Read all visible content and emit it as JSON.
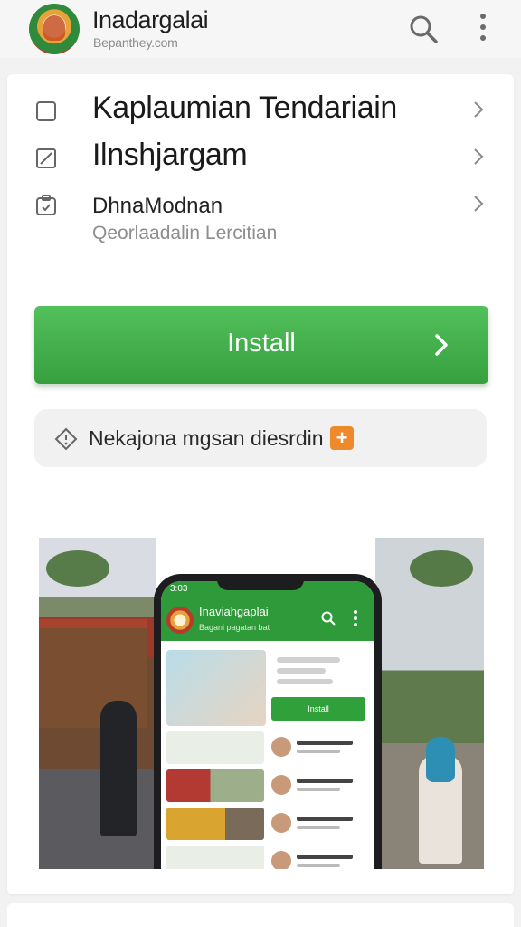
{
  "app_bar": {
    "title": "Inadargalai",
    "subtitle": "Bepanthey.com",
    "logo_icon": "emblem-logo",
    "search_icon": "search-icon",
    "more_icon": "more-vertical-icon"
  },
  "menu": {
    "items": [
      {
        "label": "Kaplaumian Tendariain",
        "icon": "checkbox-icon"
      },
      {
        "label": "Ilnshjargam",
        "icon": "edit-icon"
      },
      {
        "label": "DhnaModnan",
        "sublabel": "Qeorlaadalin Lercitian",
        "icon": "clipboard-icon"
      }
    ]
  },
  "install_button": {
    "label": "Install",
    "arrow_icon": "chevron-right-icon",
    "color": "#43b04c"
  },
  "notice": {
    "text": "Nekajona mgsan diesrdin",
    "icon": "diamond-info-icon",
    "plus_icon": "plus-icon",
    "plus_color": "#ef8a2c"
  },
  "preview": {
    "status_time": "3:03",
    "app_title": "Inaviahgaplai",
    "app_subtitle": "Bagani pagatan bat",
    "button_label": "Install"
  },
  "colors": {
    "accent": "#2f9a3a",
    "background": "#f2f2f3"
  }
}
